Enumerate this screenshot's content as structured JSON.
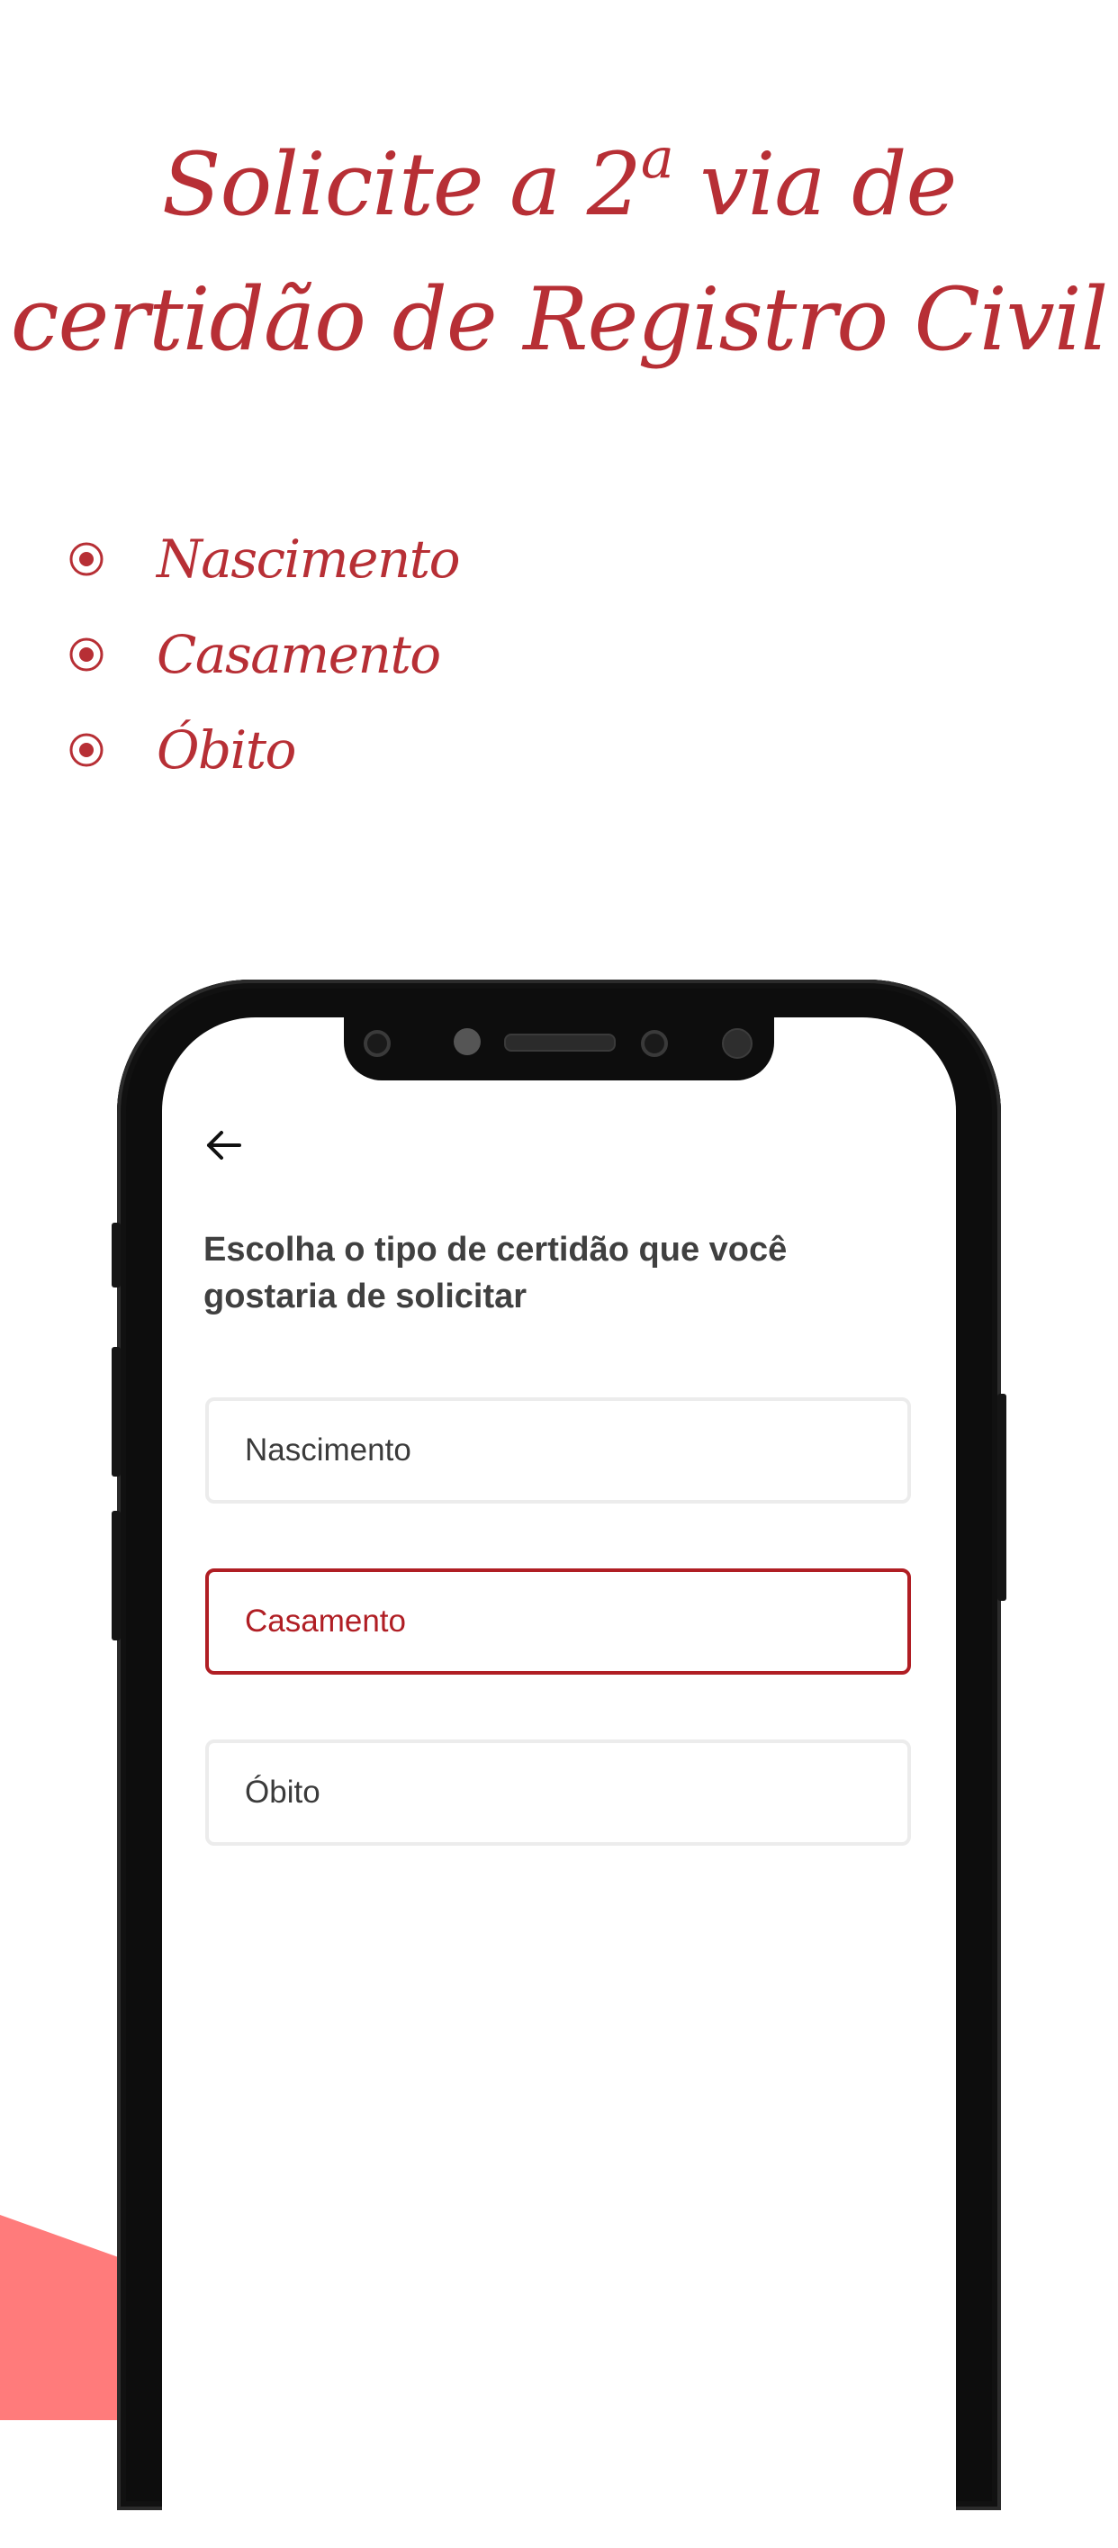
{
  "headline": {
    "line1_before": "Solicite a 2",
    "line1_sup": "a",
    "line1_after": " via de",
    "line2": "certidão de Registro Civil"
  },
  "features": [
    {
      "label": "Nascimento",
      "icon": "radio-dot-icon"
    },
    {
      "label": "Casamento",
      "icon": "radio-dot-icon"
    },
    {
      "label": "Óbito",
      "icon": "radio-dot-icon"
    }
  ],
  "app": {
    "back_icon": "arrow-left-icon",
    "question": "Escolha o tipo de certidão que você gostaria de solicitar",
    "options": [
      {
        "label": "Nascimento",
        "selected": false
      },
      {
        "label": "Casamento",
        "selected": true
      },
      {
        "label": "Óbito",
        "selected": false
      }
    ]
  },
  "colors": {
    "accent": "#b72f35",
    "selected": "#b01e24",
    "decor": "#ff7b7b"
  }
}
